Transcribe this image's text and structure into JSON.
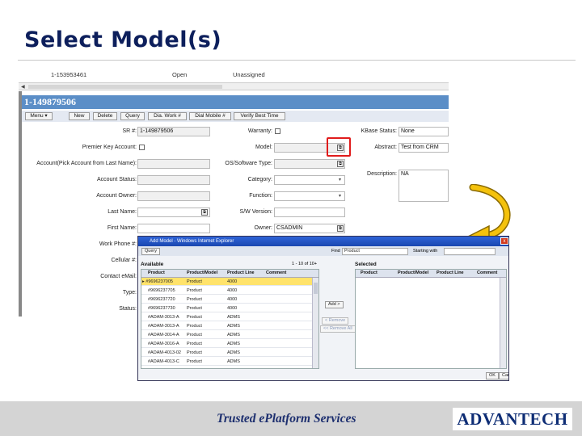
{
  "slide": {
    "title": "Select Model(s)"
  },
  "background_list": {
    "row_id": "1-153953461",
    "status": "Open",
    "owner": "Unassigned"
  },
  "sr_form": {
    "header": "1-149879506",
    "buttons": [
      "Menu ▾",
      "New",
      "Delete",
      "Query",
      "Dia. Work #",
      "Dial Mobile #",
      "Verify Best Time"
    ],
    "fields": {
      "sr_number": {
        "label": "SR #:",
        "value": "1-149879506"
      },
      "premier_key": {
        "label": "Premier Key Account:"
      },
      "account": {
        "label": "Account(Pick Account from Last Name):"
      },
      "account_status": {
        "label": "Account Status:"
      },
      "account_owner": {
        "label": "Account Owner:"
      },
      "last_name": {
        "label": "Last Name:"
      },
      "first_name": {
        "label": "First Name:"
      },
      "work_phone": {
        "label": "Work Phone #:"
      },
      "cellular": {
        "label": "Cellular #:"
      },
      "contact_email": {
        "label": "Contact eMail:"
      },
      "type": {
        "label": "Type:"
      },
      "status": {
        "label": "Status:"
      },
      "warranty": {
        "label": "Warranty:"
      },
      "model": {
        "label": "Model:"
      },
      "os_software": {
        "label": "OS/Software Type:"
      },
      "category": {
        "label": "Category:"
      },
      "function": {
        "label": "Function:"
      },
      "sw_version": {
        "label": "S/W Version:"
      },
      "owner": {
        "label": "Owner:",
        "value": "CSADMIN"
      },
      "kbase_status": {
        "label": "KBase Status:",
        "value": "None"
      },
      "abstract": {
        "label": "Abstract:",
        "value": "Test from CRM"
      },
      "description": {
        "label": "Description:",
        "value": "NA"
      }
    }
  },
  "popup": {
    "title": "Add Model - Windows Internet Explorer",
    "close": "x",
    "query_button": "Query",
    "find_label": "Find",
    "find_value": "Product",
    "starting_with_label": "Starting with",
    "available_label": "Available",
    "record_count": "1 - 10 of 10+",
    "selected_label": "Selected",
    "available_columns": [
      "Product",
      "Product/Model",
      "Product Line",
      "Comment"
    ],
    "selected_columns": [
      "Product",
      "Product/Model",
      "Product Line",
      "Comment"
    ],
    "rows": [
      {
        "product": "#9696237005",
        "type": "Product",
        "line": "4000"
      },
      {
        "product": "#9696237705",
        "type": "Product",
        "line": "4000"
      },
      {
        "product": "#9696237720",
        "type": "Product",
        "line": "4000"
      },
      {
        "product": "#9696237730",
        "type": "Product",
        "line": "4000"
      },
      {
        "product": "#ADAM-3013-A",
        "type": "Product",
        "line": "ADMS"
      },
      {
        "product": "#ADAM-3013-A",
        "type": "Product",
        "line": "ADMS"
      },
      {
        "product": "#ADAM-3014-A",
        "type": "Product",
        "line": "ADMS"
      },
      {
        "product": "#ADAM-3016-A",
        "type": "Product",
        "line": "ADMS"
      },
      {
        "product": "#ADAM-4013-02",
        "type": "Product",
        "line": "ADMS"
      },
      {
        "product": "#ADAM-4013-C",
        "type": "Product",
        "line": "ADMS"
      }
    ],
    "buttons": {
      "add": "Add >",
      "remove": "< Remove",
      "remove_all": "<< Remove All",
      "ok": "OK",
      "cancel": "Cancel"
    }
  },
  "footer": {
    "tagline": "Trusted ePlatform Services",
    "logo": "ADVANTECH"
  },
  "colors": {
    "title": "#0d1f5c",
    "header_bar": "#5b8ec7",
    "highlight": "#e01c1c",
    "arrow": "#f4c20d",
    "selected_row": "#ffe36b"
  }
}
